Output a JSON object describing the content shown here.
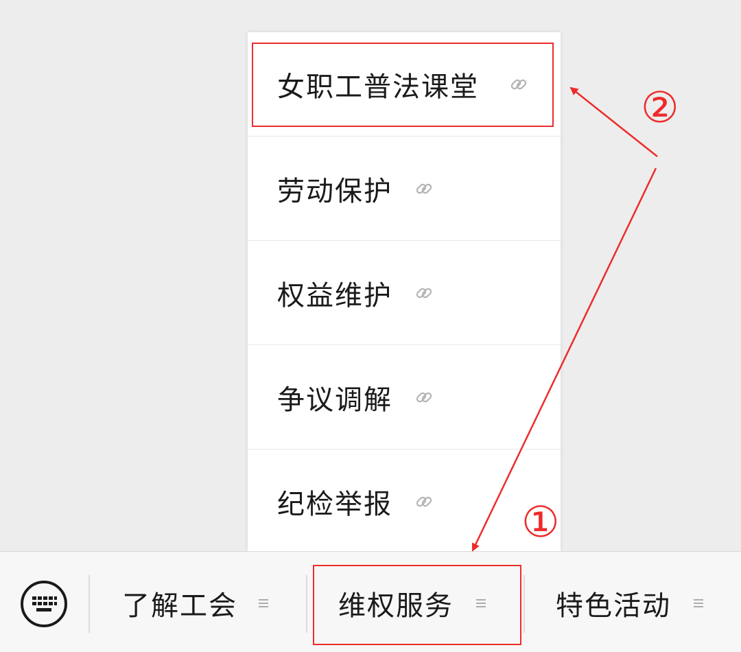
{
  "submenu": {
    "items": [
      {
        "label": "女职工普法课堂",
        "icon": "link-icon"
      },
      {
        "label": "劳动保护",
        "icon": "link-icon"
      },
      {
        "label": "权益维护",
        "icon": "link-icon"
      },
      {
        "label": "争议调解",
        "icon": "link-icon"
      },
      {
        "label": "纪检举报",
        "icon": "link-icon"
      }
    ]
  },
  "menubar": {
    "keyboard_icon": "keyboard-icon",
    "tabs": [
      {
        "label": "了解工会",
        "icon": "menu-lines-icon"
      },
      {
        "label": "维权服务",
        "icon": "menu-lines-icon"
      },
      {
        "label": "特色活动",
        "icon": "menu-lines-icon"
      }
    ]
  },
  "annotations": {
    "step1": "①",
    "step2": "②",
    "color": "#ee2b2b"
  },
  "colors": {
    "background": "#ededed",
    "panel": "#ffffff",
    "menubar": "#f7f7f7",
    "icon_gray": "#b5b5b5"
  }
}
